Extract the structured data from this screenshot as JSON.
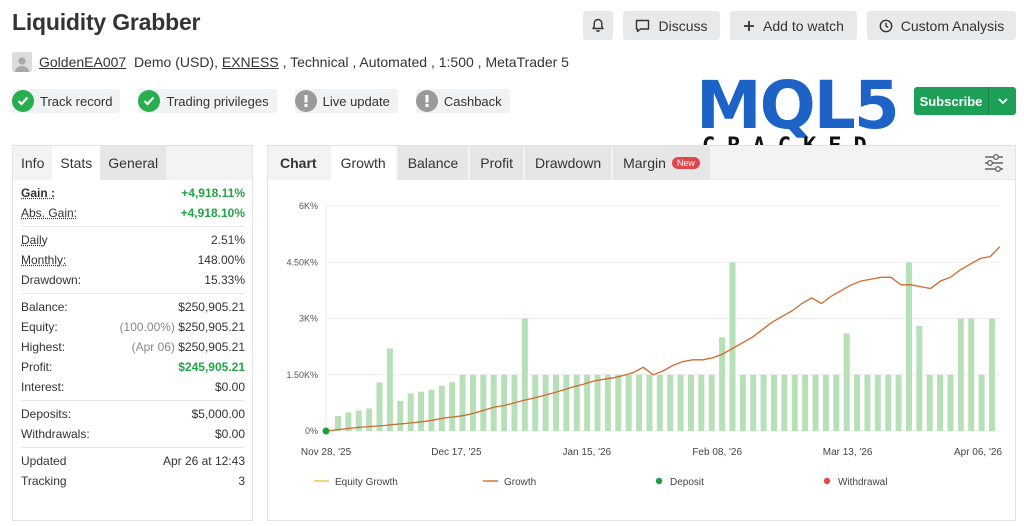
{
  "header": {
    "title": "Liquidity Grabber",
    "discuss_label": "Discuss",
    "add_to_watch_label": "Add to watch",
    "custom_analysis_label": "Custom Analysis"
  },
  "meta": {
    "author": "GoldenEA007",
    "account_type": "Demo (USD), ",
    "broker": "EXNESS",
    "details": " , Technical , Automated , 1:500 , MetaTrader 5"
  },
  "badges": [
    {
      "label": "Track record",
      "status": "ok"
    },
    {
      "label": "Trading privileges",
      "status": "ok"
    },
    {
      "label": "Live update",
      "status": "warn"
    },
    {
      "label": "Cashback",
      "status": "warn"
    }
  ],
  "logo": {
    "text": "MQL5",
    "sub": "CRACKED"
  },
  "subscribe_label": "Subscribe",
  "left_tabs": [
    "Info",
    "Stats",
    "General"
  ],
  "stats": [
    [
      {
        "k": "Gain :",
        "v": "+4,918.11%",
        "kstyle": "ub",
        "vstyle": "g"
      },
      {
        "k": "Abs. Gain:",
        "v": "+4,918.10%",
        "kstyle": "u",
        "vstyle": "g"
      }
    ],
    [
      {
        "k": "Daily",
        "v": "2.51%",
        "kstyle": "u"
      },
      {
        "k": "Monthly:",
        "v": "148.00%",
        "kstyle": "u"
      },
      {
        "k": "Drawdown:",
        "v": "15.33%"
      }
    ],
    [
      {
        "k": "Balance:",
        "v": "$250,905.21"
      },
      {
        "k": "Equity:",
        "pre": "(100.00%)",
        "v": "$250,905.21"
      },
      {
        "k": "Highest:",
        "pre": "(Apr 06)",
        "v": "$250,905.21"
      },
      {
        "k": "Profit:",
        "v": "$245,905.21",
        "vstyle": "g"
      },
      {
        "k": "Interest:",
        "v": "$0.00"
      }
    ],
    [
      {
        "k": "Deposits:",
        "v": "$5,000.00"
      },
      {
        "k": "Withdrawals:",
        "v": "$0.00"
      }
    ],
    [
      {
        "k": "Updated",
        "v": "Apr 26 at 12:43"
      },
      {
        "k": "Tracking",
        "v": "3"
      }
    ]
  ],
  "chart_tabs": {
    "label": "Chart",
    "items": [
      "Growth",
      "Balance",
      "Profit",
      "Drawdown",
      "Margin"
    ],
    "active": "Growth",
    "new_badge": "New"
  },
  "colors": {
    "growth_line": "#cf6b2e",
    "equity_line": "#f0c040",
    "bars": "#b8e0b8",
    "deposit": "#1e9e3e",
    "withdrawal": "#e14b4b",
    "accent_green": "#1d9f57"
  },
  "chart_data": {
    "type": "bar",
    "ylim": [
      0,
      6000
    ],
    "y_ticks": [
      0,
      1500,
      3000,
      4500,
      6000
    ],
    "y_tick_labels": [
      "0%",
      "1.50K%",
      "3K%",
      "4.50K%",
      "6K%"
    ],
    "x_tick_labels": [
      "Nov 28, '25",
      "Dec 17, '25",
      "Jan 15, '26",
      "Feb 08, '26",
      "Mar 13, '26",
      "Apr 06, '26"
    ],
    "bar_values": [
      400,
      500,
      550,
      600,
      1300,
      2200,
      800,
      1000,
      1050,
      1100,
      1200,
      1300,
      1500,
      1500,
      1500,
      1500,
      1500,
      1500,
      3000,
      1500,
      1500,
      1500,
      1500,
      1500,
      1500,
      1500,
      1500,
      1500,
      1500,
      1500,
      1500,
      1500,
      1500,
      1500,
      1500,
      1500,
      1500,
      2500,
      4500,
      1500,
      1500,
      1500,
      1500,
      1500,
      1500,
      1500,
      1500,
      1500,
      1500,
      2600,
      1500,
      1500,
      1500,
      1500,
      1500,
      4500,
      2800,
      1500,
      1500,
      1500,
      3000,
      3000,
      1500,
      3000
    ],
    "growth_line": [
      0,
      30,
      60,
      90,
      110,
      130,
      150,
      180,
      200,
      230,
      260,
      300,
      350,
      380,
      420,
      480,
      560,
      640,
      680,
      750,
      820,
      880,
      950,
      1020,
      1100,
      1180,
      1250,
      1330,
      1380,
      1420,
      1480,
      1560,
      1700,
      1500,
      1600,
      1750,
      1850,
      1900,
      1900,
      1950,
      2050,
      2200,
      2350,
      2500,
      2700,
      2900,
      3050,
      3200,
      3400,
      3550,
      3400,
      3600,
      3750,
      3900,
      4000,
      4050,
      4100,
      4100,
      3900,
      3900,
      3850,
      3800,
      4000,
      4100,
      4300,
      4450,
      4600,
      4650,
      4918
    ],
    "series": [
      {
        "name": "Equity Growth"
      },
      {
        "name": "Growth"
      },
      {
        "name": "Deposit"
      },
      {
        "name": "Withdrawal"
      }
    ]
  }
}
